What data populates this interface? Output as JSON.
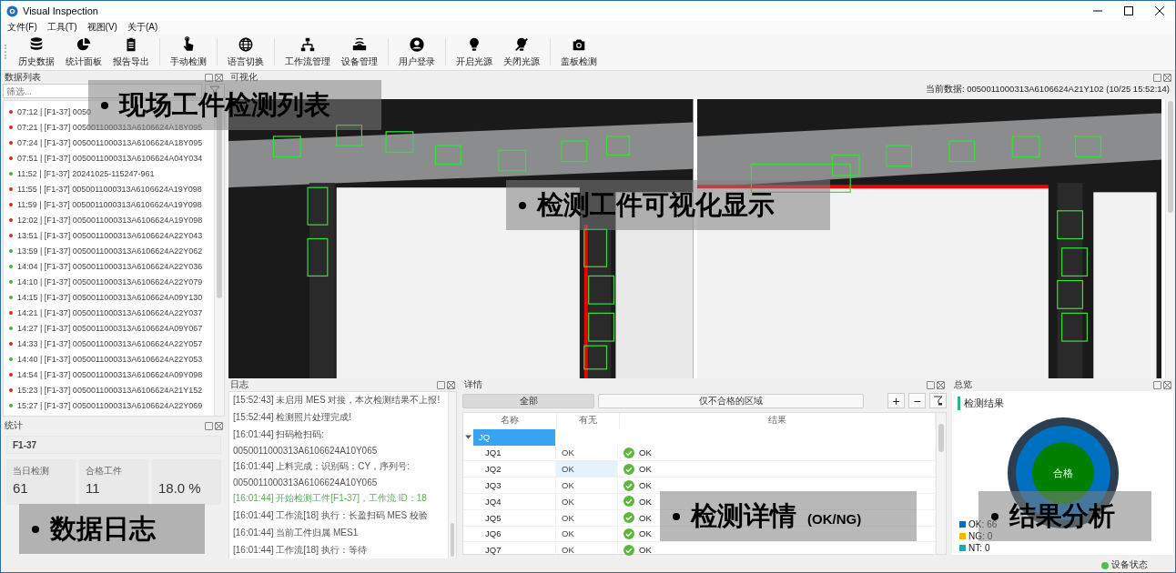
{
  "window": {
    "title": "Visual Inspection"
  },
  "menu": [
    "文件(F)",
    "工具(T)",
    "视图(V)",
    "关于(A)"
  ],
  "toolbar": [
    [
      {
        "label": "历史数据"
      },
      {
        "label": "统计面板"
      },
      {
        "label": "报告导出"
      }
    ],
    [
      {
        "label": "手动检测"
      }
    ],
    [
      {
        "label": "语言切换"
      }
    ],
    [
      {
        "label": "工作流管理"
      },
      {
        "label": "设备管理"
      }
    ],
    [
      {
        "label": "用户登录"
      }
    ],
    [
      {
        "label": "开启光源"
      },
      {
        "label": "关闭光源"
      }
    ],
    [
      {
        "label": "盖板检测"
      }
    ]
  ],
  "data_list": {
    "title": "数据列表",
    "filter": {
      "placeholder": "筛选..."
    },
    "rows": [
      {
        "text": "07:12 | [F1-37] 0050",
        "color": "#e02020"
      },
      {
        "text": "07:21 | [F1-37] 0050011000313A6106624A18Y095",
        "color": "#e02020"
      },
      {
        "text": "07:24 | [F1-37] 0050011000313A6106624A18Y095",
        "color": "#e02020"
      },
      {
        "text": "07:51 | [F1-37] 0050011000313A6106624A04Y034",
        "color": "#e02020"
      },
      {
        "text": "11:52 | [F1-37] 20241025-115247-961",
        "color": "#40b040"
      },
      {
        "text": "11:55 | [F1-37] 0050011000313A6106624A19Y098",
        "color": "#e02020"
      },
      {
        "text": "11:59 | [F1-37] 0050011000313A6106624A19Y098",
        "color": "#e02020"
      },
      {
        "text": "12:02 | [F1-37] 0050011000313A6106624A19Y098",
        "color": "#e02020"
      },
      {
        "text": "13:51 | [F1-37] 0050011000313A6106624A22Y043",
        "color": "#e02020"
      },
      {
        "text": "13:59 | [F1-37] 0050011000313A6106624A22Y062",
        "color": "#40b040"
      },
      {
        "text": "14:04 | [F1-37] 0050011000313A6106624A22Y036",
        "color": "#40b040"
      },
      {
        "text": "14:10 | [F1-37] 0050011000313A6106624A22Y079",
        "color": "#40b040"
      },
      {
        "text": "14:15 | [F1-37] 0050011000313A6106624A09Y130",
        "color": "#40b040"
      },
      {
        "text": "14:21 | [F1-37] 0050011000313A6106624A22Y037",
        "color": "#e02020"
      },
      {
        "text": "14:27 | [F1-37] 0050011000313A6106624A09Y067",
        "color": "#40b040"
      },
      {
        "text": "14:33 | [F1-37] 0050011000313A6106624A22Y057",
        "color": "#e02020"
      },
      {
        "text": "14:40 | [F1-37] 0050011000313A6106624A22Y053",
        "color": "#40b040"
      },
      {
        "text": "14:54 | [F1-37] 0050011000313A6106624A09Y098",
        "color": "#e02020"
      },
      {
        "text": "15:23 | [F1-37] 0050011000313A6106624A21Y152",
        "color": "#e02020"
      },
      {
        "text": "15:27 | [F1-37] 0050011000313A6106624A22Y069",
        "color": "#40b040"
      }
    ]
  },
  "stats": {
    "title": "统计",
    "station": "F1-37",
    "cards": [
      {
        "label": "当日检测",
        "value": "61"
      },
      {
        "label": "合格工件",
        "value": "11"
      },
      {
        "value": "18.0 %"
      }
    ]
  },
  "visualization": {
    "title": "可视化",
    "current": "当前数据: 0050011000313A6106624A21Y102 (10/25 15:52:14)"
  },
  "log": {
    "title": "日志",
    "entries": [
      {
        "text": "[15:52:43] 未启用 MES 对接，本次检测结果不上报!",
        "kind": "info"
      },
      {
        "text": "[15:52:44] 检测照片处理完成!",
        "kind": "info"
      },
      {
        "text": "[16:01:44] 扫码枪扫码:",
        "kind": "info"
      },
      {
        "text": "0050011000313A6106624A10Y065",
        "kind": "info"
      },
      {
        "text": "[16:01:44] 上料完成：识别码：CY，序列号:",
        "kind": "info"
      },
      {
        "text": "0050011000313A6106624A10Y065",
        "kind": "info"
      },
      {
        "text": "[16:01:44] 开始检测工件[F1-37]，工作流 ID：18",
        "kind": "success"
      },
      {
        "text": "[16:01:44] 工作流[18] 执行：长盈扫码 MES 校验",
        "kind": "info"
      },
      {
        "text": "[16:01:44] 当前工件归属 MES1",
        "kind": "info"
      },
      {
        "text": "[16:01:44] 工作流[18] 执行：等待",
        "kind": "info"
      }
    ]
  },
  "details": {
    "title": "详情",
    "filters": [
      {
        "label": "全部",
        "selected": true
      },
      {
        "label": "仅不合格的区域",
        "selected": false
      }
    ],
    "buttons": [
      "+",
      "−"
    ],
    "columns": [
      "名称",
      "有无",
      "结果"
    ],
    "groups": [
      {
        "name": "JQ",
        "expanded": true,
        "selected": true,
        "children": [
          {
            "name": "JQ1",
            "presence": "OK",
            "result": "OK",
            "pass": true,
            "selected": false
          },
          {
            "name": "JQ2",
            "presence": "OK",
            "result": "OK",
            "pass": true,
            "selected": true
          },
          {
            "name": "JQ3",
            "presence": "OK",
            "result": "OK",
            "pass": true,
            "selected": false
          },
          {
            "name": "JQ4",
            "presence": "OK",
            "result": "OK",
            "pass": true,
            "selected": false
          },
          {
            "name": "JQ5",
            "presence": "OK",
            "result": "OK",
            "pass": true,
            "selected": false
          },
          {
            "name": "JQ6",
            "presence": "OK",
            "result": "OK",
            "pass": true,
            "selected": false
          },
          {
            "name": "JQ7",
            "presence": "OK",
            "result": "OK",
            "pass": true,
            "selected": false
          }
        ]
      }
    ]
  },
  "overview": {
    "title": "总览",
    "heading": "检测结果",
    "verdict": "合格",
    "legend": [
      {
        "label": "OK:",
        "value": "66",
        "color": "#0070c0"
      },
      {
        "label": "NG:",
        "value": "0",
        "color": "#f5b800"
      },
      {
        "label": "NT:",
        "value": "0",
        "color": "#1aabb0"
      }
    ]
  },
  "status_bar": {
    "device": "设备状态",
    "online": true
  },
  "callouts": [
    {
      "text": "现场工件检测列表"
    },
    {
      "text": "检测工件可视化显示"
    },
    {
      "text": "数据日志"
    },
    {
      "text": "检测详情",
      "note": "(OK/NG)"
    },
    {
      "text": "结果分析"
    }
  ]
}
